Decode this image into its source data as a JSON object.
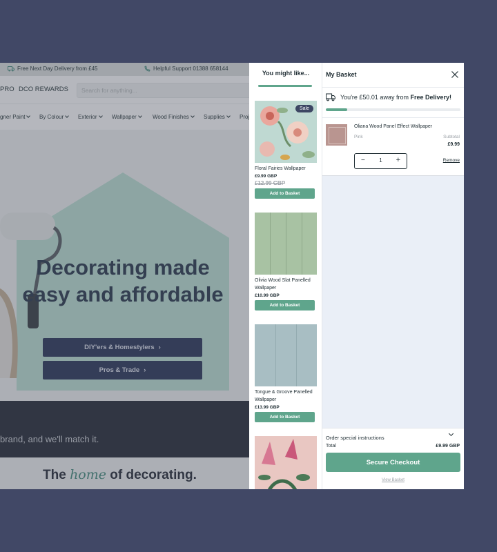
{
  "site": {
    "topbar": {
      "delivery": "Free Next Day Delivery from £45",
      "support": "Helpful Support 01388 658144"
    },
    "nav": {
      "pro": "PRO",
      "rewards": "DCO REWARDS",
      "search_placeholder": "Search for anything..."
    },
    "categories": [
      "gner Paint",
      "By Colour",
      "Exterior",
      "Wallpaper",
      "Wood Finishes",
      "Supplies",
      "Proj"
    ],
    "hero": {
      "title_line1": "Decorating made",
      "title_line2": "easy and affordable",
      "button1": "DIY'ers & Homestylers",
      "button2": "Pros & Trade"
    },
    "band_text": "brand, and we'll match it.",
    "tagline": {
      "pre": "The",
      "em": "home",
      "post": "of decorating."
    }
  },
  "recommendations": {
    "title": "You might like...",
    "products": [
      {
        "name": "Floral Fairies Wallpaper",
        "price": "£9.99 GBP",
        "was": "£12.99 GBP",
        "badge": "Sale",
        "button": "Add to Basket"
      },
      {
        "name": "Olivia Wood Slat Panelled Wallpaper",
        "price": "£10.99 GBP",
        "button": "Add to Basket"
      },
      {
        "name": "Tongue & Groove Panelled Wallpaper",
        "price": "£13.99 GBP",
        "button": "Add to Basket"
      }
    ]
  },
  "basket": {
    "title": "My Basket",
    "delivery_prefix": "You're £50.01 away from ",
    "delivery_bold": "Free Delivery!",
    "delivery_progress": 0.16,
    "item": {
      "name": "Oliana Wood Panel Effect Wallpaper",
      "variant": "Pink",
      "subtotal_label": "Subtotal",
      "subtotal": "£9.99",
      "quantity": "1",
      "remove": "Remove"
    },
    "instructions": "Order special instructions",
    "total_label": "Total",
    "total": "£9.99 GBP",
    "checkout": "Secure Checkout",
    "view": "View Basket"
  },
  "colors": {
    "accent": "#5fa58c",
    "navy": "#2f3a5c",
    "backdrop": "#414866"
  }
}
